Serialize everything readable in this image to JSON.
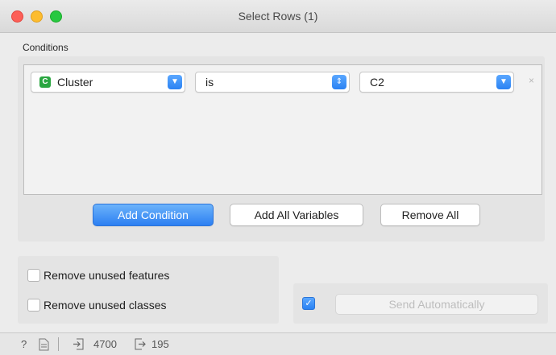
{
  "window": {
    "title": "Select Rows (1)"
  },
  "conditions": {
    "label": "Conditions",
    "rows": [
      {
        "attribute": "Cluster",
        "attribute_type_badge": "C",
        "operator": "is",
        "value": "C2",
        "remove_icon": "×"
      }
    ]
  },
  "buttons": {
    "add_condition": "Add Condition",
    "add_all_variables": "Add All Variables",
    "remove_all": "Remove All"
  },
  "options": {
    "remove_unused_features": {
      "label": "Remove unused features",
      "checked": false
    },
    "remove_unused_classes": {
      "label": "Remove unused classes",
      "checked": false
    }
  },
  "send": {
    "auto_checked": true,
    "label": "Send Automatically"
  },
  "status": {
    "input_count": "4700",
    "output_count": "195",
    "help_icon": "?",
    "report_icon": "document-icon"
  },
  "colors": {
    "accent": "#2c7ff2",
    "badge": "#2aa640"
  }
}
